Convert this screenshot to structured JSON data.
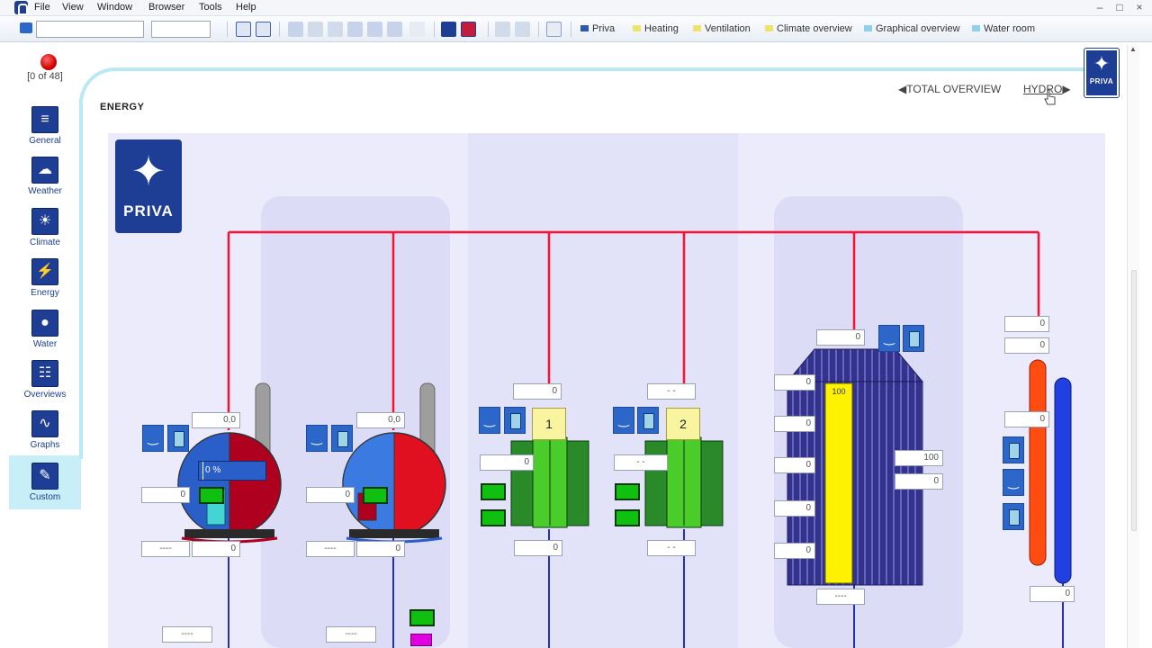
{
  "menu": [
    "File",
    "View",
    "Window",
    "Browser",
    "Tools",
    "Help"
  ],
  "toolbar": {
    "links": [
      {
        "label": "Priva",
        "color": "#2f56b3"
      },
      {
        "label": "Heating",
        "color": "#f0e36a"
      },
      {
        "label": "Ventilation",
        "color": "#f0e36a"
      },
      {
        "label": "Climate overview",
        "color": "#f0e36a"
      },
      {
        "label": "Graphical overview",
        "color": "#8fd0ee"
      },
      {
        "label": "Water room",
        "color": "#8fd0ee"
      }
    ]
  },
  "sidebar": {
    "alarm_count": "[0 of 48]",
    "items": [
      {
        "label": "General",
        "icon": "general-icon",
        "glyph": "≡"
      },
      {
        "label": "Weather",
        "icon": "weather-icon",
        "glyph": "☁"
      },
      {
        "label": "Climate",
        "icon": "climate-icon",
        "glyph": "☀"
      },
      {
        "label": "Energy",
        "icon": "energy-icon",
        "glyph": "⚡"
      },
      {
        "label": "Water",
        "icon": "water-icon",
        "glyph": "●"
      },
      {
        "label": "Overviews",
        "icon": "overviews-icon",
        "glyph": "☷"
      },
      {
        "label": "Graphs",
        "icon": "graphs-icon",
        "glyph": "∿"
      },
      {
        "label": "Custom",
        "icon": "custom-icon",
        "glyph": "✎"
      }
    ],
    "active": "Custom"
  },
  "page": {
    "title": "ENERGY",
    "nav_prev": "TOTAL OVERVIEW",
    "nav_next": "HYDRO",
    "logo_text": "PRIVA"
  },
  "diagram": {
    "boiler1": {
      "top_value": "0,0",
      "percent": "0 %",
      "side_value": "0",
      "bottom_left": "----",
      "bottom_right": "0"
    },
    "boiler2": {
      "top_value": "0,0",
      "side_value": "0",
      "bottom_left": "----",
      "bottom_right": "0"
    },
    "exchanger1": {
      "label": "1",
      "top_value": "0",
      "side_value": "0",
      "bottom_value": "0"
    },
    "exchanger2": {
      "label": "2",
      "top_value": "- -",
      "side_value": "- -",
      "bottom_value": "- -"
    },
    "buffer_tank": {
      "top_value": "0",
      "fill_value": "100",
      "side_fields": [
        "0",
        "0",
        "0",
        "0",
        "0"
      ],
      "right_top": "100",
      "right_bottom": "0",
      "bottom_value": "----"
    },
    "header": {
      "top1": "0",
      "top2": "0",
      "mid": "0",
      "bottom": "0"
    },
    "bottom_fields": [
      "----",
      "----"
    ]
  }
}
